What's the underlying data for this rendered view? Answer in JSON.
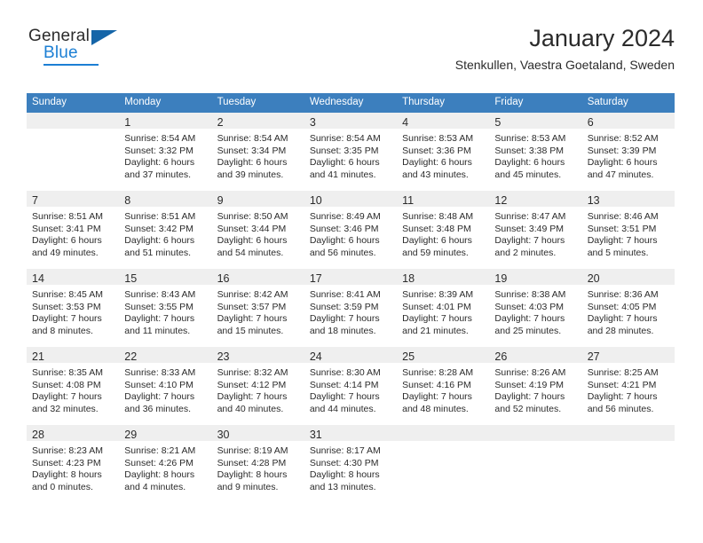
{
  "brand": {
    "name_top": "General",
    "name_bottom": "Blue",
    "logo_icon": "triangle-flag-icon",
    "accent_color": "#1c7fd4",
    "flag_color": "#1565a8"
  },
  "header": {
    "title": "January 2024",
    "subtitle": "Stenkullen, Vaestra Goetaland, Sweden"
  },
  "theme": {
    "header_bg": "#3c7fbe",
    "week_separator": "#1f5fa8",
    "daynum_band": "#efefef",
    "text": "#2b2b2b"
  },
  "calendar": {
    "weekday_headers": [
      "Sunday",
      "Monday",
      "Tuesday",
      "Wednesday",
      "Thursday",
      "Friday",
      "Saturday"
    ],
    "labels": {
      "sunrise": "Sunrise:",
      "sunset": "Sunset:",
      "daylight": "Daylight:"
    },
    "weeks": [
      [
        {
          "day": ""
        },
        {
          "day": "1",
          "sunrise": "Sunrise: 8:54 AM",
          "sunset": "Sunset: 3:32 PM",
          "daylight_1": "Daylight: 6 hours",
          "daylight_2": "and 37 minutes."
        },
        {
          "day": "2",
          "sunrise": "Sunrise: 8:54 AM",
          "sunset": "Sunset: 3:34 PM",
          "daylight_1": "Daylight: 6 hours",
          "daylight_2": "and 39 minutes."
        },
        {
          "day": "3",
          "sunrise": "Sunrise: 8:54 AM",
          "sunset": "Sunset: 3:35 PM",
          "daylight_1": "Daylight: 6 hours",
          "daylight_2": "and 41 minutes."
        },
        {
          "day": "4",
          "sunrise": "Sunrise: 8:53 AM",
          "sunset": "Sunset: 3:36 PM",
          "daylight_1": "Daylight: 6 hours",
          "daylight_2": "and 43 minutes."
        },
        {
          "day": "5",
          "sunrise": "Sunrise: 8:53 AM",
          "sunset": "Sunset: 3:38 PM",
          "daylight_1": "Daylight: 6 hours",
          "daylight_2": "and 45 minutes."
        },
        {
          "day": "6",
          "sunrise": "Sunrise: 8:52 AM",
          "sunset": "Sunset: 3:39 PM",
          "daylight_1": "Daylight: 6 hours",
          "daylight_2": "and 47 minutes."
        }
      ],
      [
        {
          "day": "7",
          "sunrise": "Sunrise: 8:51 AM",
          "sunset": "Sunset: 3:41 PM",
          "daylight_1": "Daylight: 6 hours",
          "daylight_2": "and 49 minutes."
        },
        {
          "day": "8",
          "sunrise": "Sunrise: 8:51 AM",
          "sunset": "Sunset: 3:42 PM",
          "daylight_1": "Daylight: 6 hours",
          "daylight_2": "and 51 minutes."
        },
        {
          "day": "9",
          "sunrise": "Sunrise: 8:50 AM",
          "sunset": "Sunset: 3:44 PM",
          "daylight_1": "Daylight: 6 hours",
          "daylight_2": "and 54 minutes."
        },
        {
          "day": "10",
          "sunrise": "Sunrise: 8:49 AM",
          "sunset": "Sunset: 3:46 PM",
          "daylight_1": "Daylight: 6 hours",
          "daylight_2": "and 56 minutes."
        },
        {
          "day": "11",
          "sunrise": "Sunrise: 8:48 AM",
          "sunset": "Sunset: 3:48 PM",
          "daylight_1": "Daylight: 6 hours",
          "daylight_2": "and 59 minutes."
        },
        {
          "day": "12",
          "sunrise": "Sunrise: 8:47 AM",
          "sunset": "Sunset: 3:49 PM",
          "daylight_1": "Daylight: 7 hours",
          "daylight_2": "and 2 minutes."
        },
        {
          "day": "13",
          "sunrise": "Sunrise: 8:46 AM",
          "sunset": "Sunset: 3:51 PM",
          "daylight_1": "Daylight: 7 hours",
          "daylight_2": "and 5 minutes."
        }
      ],
      [
        {
          "day": "14",
          "sunrise": "Sunrise: 8:45 AM",
          "sunset": "Sunset: 3:53 PM",
          "daylight_1": "Daylight: 7 hours",
          "daylight_2": "and 8 minutes."
        },
        {
          "day": "15",
          "sunrise": "Sunrise: 8:43 AM",
          "sunset": "Sunset: 3:55 PM",
          "daylight_1": "Daylight: 7 hours",
          "daylight_2": "and 11 minutes."
        },
        {
          "day": "16",
          "sunrise": "Sunrise: 8:42 AM",
          "sunset": "Sunset: 3:57 PM",
          "daylight_1": "Daylight: 7 hours",
          "daylight_2": "and 15 minutes."
        },
        {
          "day": "17",
          "sunrise": "Sunrise: 8:41 AM",
          "sunset": "Sunset: 3:59 PM",
          "daylight_1": "Daylight: 7 hours",
          "daylight_2": "and 18 minutes."
        },
        {
          "day": "18",
          "sunrise": "Sunrise: 8:39 AM",
          "sunset": "Sunset: 4:01 PM",
          "daylight_1": "Daylight: 7 hours",
          "daylight_2": "and 21 minutes."
        },
        {
          "day": "19",
          "sunrise": "Sunrise: 8:38 AM",
          "sunset": "Sunset: 4:03 PM",
          "daylight_1": "Daylight: 7 hours",
          "daylight_2": "and 25 minutes."
        },
        {
          "day": "20",
          "sunrise": "Sunrise: 8:36 AM",
          "sunset": "Sunset: 4:05 PM",
          "daylight_1": "Daylight: 7 hours",
          "daylight_2": "and 28 minutes."
        }
      ],
      [
        {
          "day": "21",
          "sunrise": "Sunrise: 8:35 AM",
          "sunset": "Sunset: 4:08 PM",
          "daylight_1": "Daylight: 7 hours",
          "daylight_2": "and 32 minutes."
        },
        {
          "day": "22",
          "sunrise": "Sunrise: 8:33 AM",
          "sunset": "Sunset: 4:10 PM",
          "daylight_1": "Daylight: 7 hours",
          "daylight_2": "and 36 minutes."
        },
        {
          "day": "23",
          "sunrise": "Sunrise: 8:32 AM",
          "sunset": "Sunset: 4:12 PM",
          "daylight_1": "Daylight: 7 hours",
          "daylight_2": "and 40 minutes."
        },
        {
          "day": "24",
          "sunrise": "Sunrise: 8:30 AM",
          "sunset": "Sunset: 4:14 PM",
          "daylight_1": "Daylight: 7 hours",
          "daylight_2": "and 44 minutes."
        },
        {
          "day": "25",
          "sunrise": "Sunrise: 8:28 AM",
          "sunset": "Sunset: 4:16 PM",
          "daylight_1": "Daylight: 7 hours",
          "daylight_2": "and 48 minutes."
        },
        {
          "day": "26",
          "sunrise": "Sunrise: 8:26 AM",
          "sunset": "Sunset: 4:19 PM",
          "daylight_1": "Daylight: 7 hours",
          "daylight_2": "and 52 minutes."
        },
        {
          "day": "27",
          "sunrise": "Sunrise: 8:25 AM",
          "sunset": "Sunset: 4:21 PM",
          "daylight_1": "Daylight: 7 hours",
          "daylight_2": "and 56 minutes."
        }
      ],
      [
        {
          "day": "28",
          "sunrise": "Sunrise: 8:23 AM",
          "sunset": "Sunset: 4:23 PM",
          "daylight_1": "Daylight: 8 hours",
          "daylight_2": "and 0 minutes."
        },
        {
          "day": "29",
          "sunrise": "Sunrise: 8:21 AM",
          "sunset": "Sunset: 4:26 PM",
          "daylight_1": "Daylight: 8 hours",
          "daylight_2": "and 4 minutes."
        },
        {
          "day": "30",
          "sunrise": "Sunrise: 8:19 AM",
          "sunset": "Sunset: 4:28 PM",
          "daylight_1": "Daylight: 8 hours",
          "daylight_2": "and 9 minutes."
        },
        {
          "day": "31",
          "sunrise": "Sunrise: 8:17 AM",
          "sunset": "Sunset: 4:30 PM",
          "daylight_1": "Daylight: 8 hours",
          "daylight_2": "and 13 minutes."
        },
        {
          "day": ""
        },
        {
          "day": ""
        },
        {
          "day": ""
        }
      ]
    ]
  }
}
